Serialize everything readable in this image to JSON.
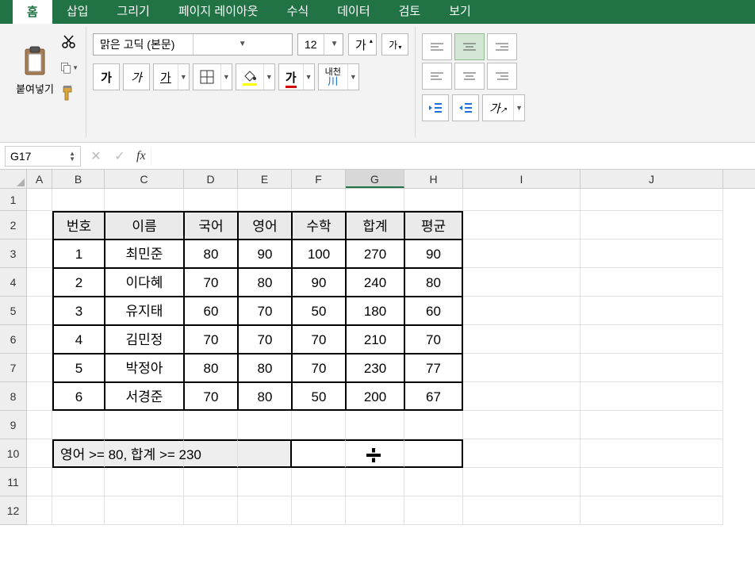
{
  "tabs": {
    "home": "홈",
    "insert": "삽입",
    "draw": "그리기",
    "page_layout": "페이지 레이아웃",
    "formulas": "수식",
    "data": "데이터",
    "review": "검토",
    "view": "보기"
  },
  "ribbon": {
    "paste_label": "붙여넣기",
    "font_name": "맑은 고딕 (본문)",
    "font_size": "12",
    "bold": "가",
    "italic": "가",
    "underline": "가",
    "grow_font": "가",
    "shrink_font": "가",
    "font_color": "가",
    "ruby": "내천",
    "ruby_sub": "川"
  },
  "formula_bar": {
    "cell_ref": "G17",
    "fx": "fx",
    "formula": ""
  },
  "columns": [
    "A",
    "B",
    "C",
    "D",
    "E",
    "F",
    "G",
    "H",
    "I",
    "J"
  ],
  "row_numbers": [
    "1",
    "2",
    "3",
    "4",
    "5",
    "6",
    "7",
    "8",
    "9",
    "10",
    "11",
    "12"
  ],
  "table": {
    "headers": [
      "번호",
      "이름",
      "국어",
      "영어",
      "수학",
      "합계",
      "평균"
    ],
    "rows": [
      [
        "1",
        "최민준",
        "80",
        "90",
        "100",
        "270",
        "90"
      ],
      [
        "2",
        "이다혜",
        "70",
        "80",
        "90",
        "240",
        "80"
      ],
      [
        "3",
        "유지태",
        "60",
        "70",
        "50",
        "180",
        "60"
      ],
      [
        "4",
        "김민정",
        "70",
        "70",
        "70",
        "210",
        "70"
      ],
      [
        "5",
        "박정아",
        "80",
        "80",
        "70",
        "230",
        "77"
      ],
      [
        "6",
        "서경준",
        "70",
        "80",
        "50",
        "200",
        "67"
      ]
    ]
  },
  "criteria": {
    "text": "영어 >= 80, 합계 >= 230"
  }
}
